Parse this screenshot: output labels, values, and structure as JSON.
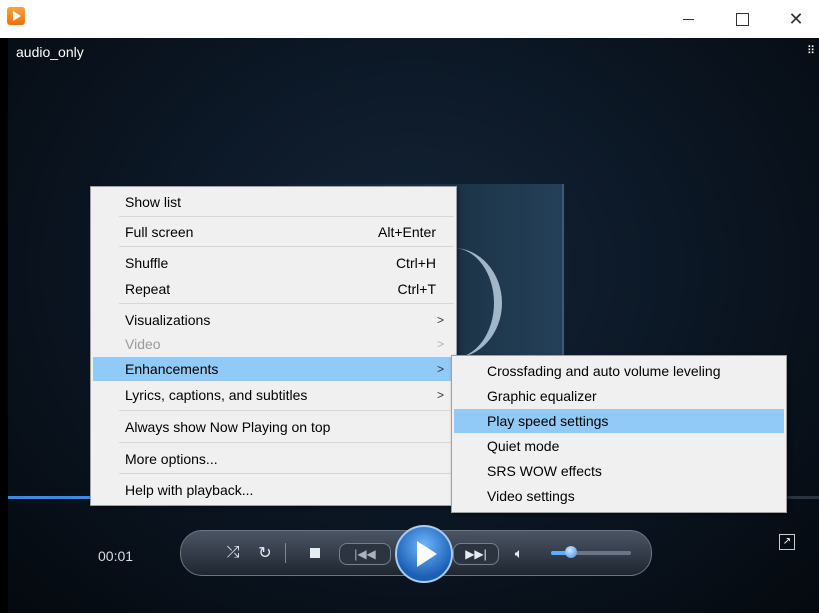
{
  "titlebar": {
    "app_icon": "media-player-icon",
    "minimize": "minimize-icon",
    "maximize": "maximize-icon",
    "close": "close-icon"
  },
  "player": {
    "media_title": "audio_only",
    "time": "00:01",
    "seek_progress": 0.11,
    "volume_level": 0.25
  },
  "context_menu": {
    "items": [
      {
        "label": "Show list",
        "shortcut": ""
      },
      {
        "label": "Full screen",
        "shortcut": "Alt+Enter"
      },
      {
        "label": "Shuffle",
        "shortcut": "Ctrl+H"
      },
      {
        "label": "Repeat",
        "shortcut": "Ctrl+T"
      },
      {
        "label": "Visualizations",
        "submenu": true
      },
      {
        "label": "Video",
        "submenu": true,
        "disabled": true
      },
      {
        "label": "Enhancements",
        "submenu": true,
        "highlighted": true
      },
      {
        "label": "Lyrics, captions, and subtitles",
        "submenu": true
      },
      {
        "label": "Always show Now Playing on top"
      },
      {
        "label": "More options..."
      },
      {
        "label": "Help with playback..."
      }
    ]
  },
  "submenu": {
    "items": [
      {
        "label": "Crossfading and auto volume leveling"
      },
      {
        "label": "Graphic equalizer"
      },
      {
        "label": "Play speed settings",
        "highlighted": true
      },
      {
        "label": "Quiet mode"
      },
      {
        "label": "SRS WOW effects"
      },
      {
        "label": "Video settings"
      }
    ]
  },
  "colors": {
    "menu_highlight": "#91c9f7",
    "seek_fill": "#3d8ad8",
    "play_button": "#1a5fb4"
  }
}
